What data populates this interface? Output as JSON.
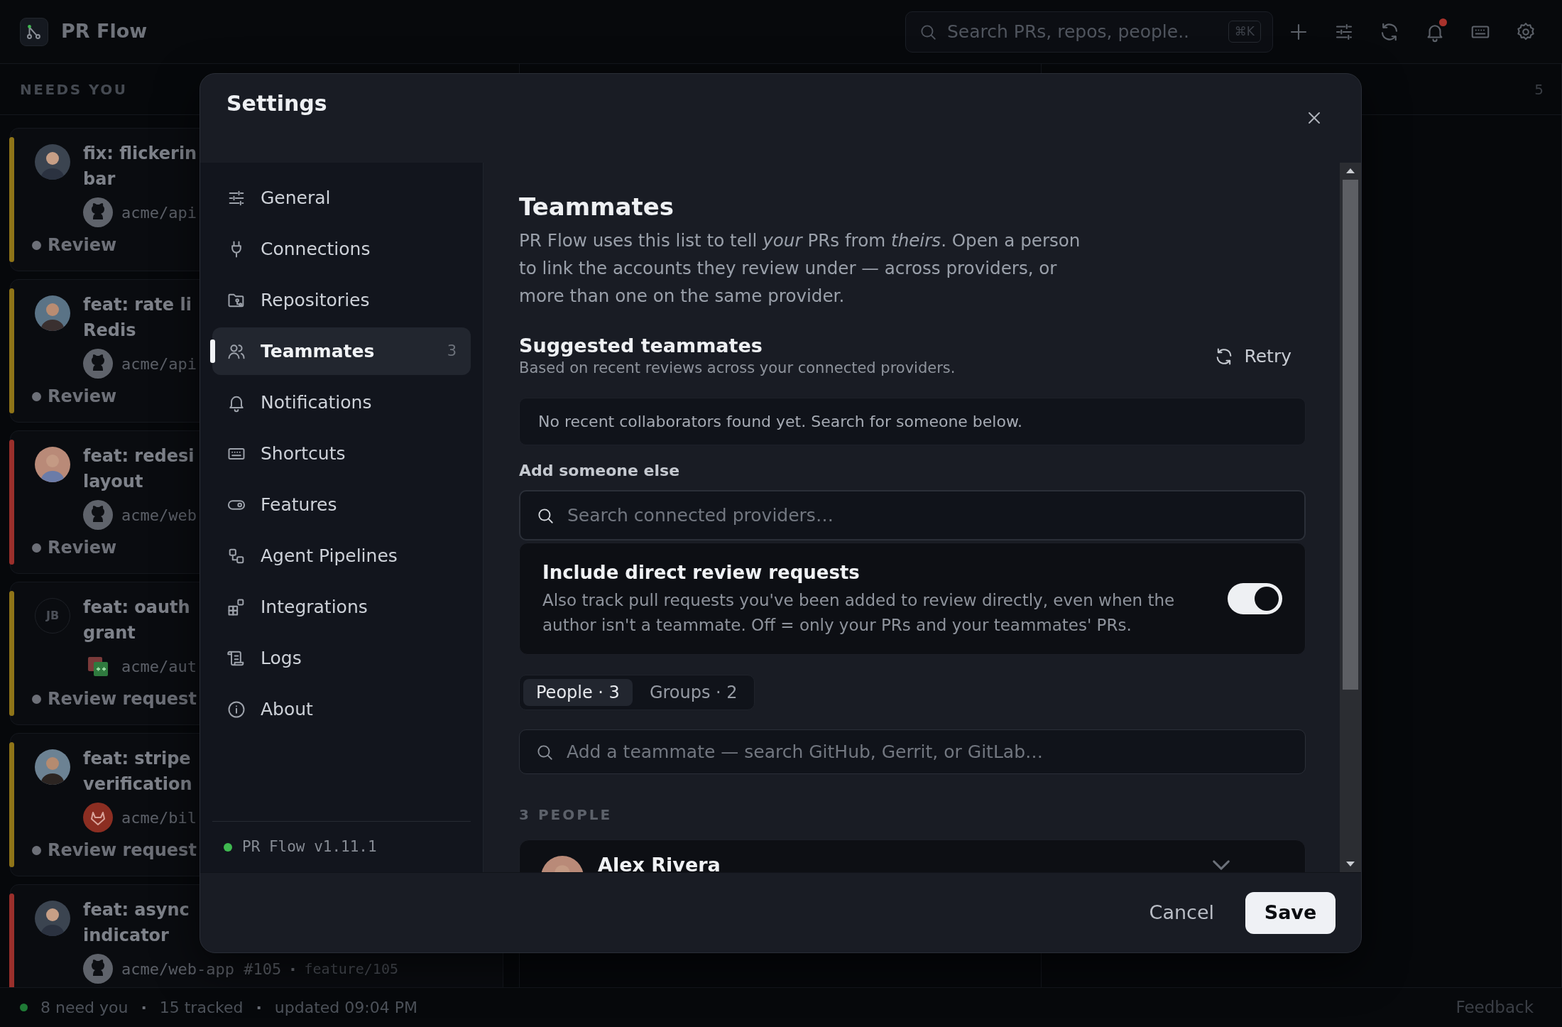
{
  "app": {
    "title": "PR Flow",
    "search": {
      "placeholder": "Search PRs, repos, people..",
      "shortcut": "⌘K"
    },
    "unread_notifications": true
  },
  "columns": [
    {
      "title": "NEEDS YOU",
      "cards": [
        {
          "title_lines": [
            "fix: flickerin",
            "bar"
          ],
          "avatar": {
            "kind": "photo"
          },
          "kind": "github",
          "repo": "acme/api",
          "status": "Review",
          "color": "#8f7418"
        },
        {
          "title_lines": [
            "feat: rate li",
            "Redis"
          ],
          "avatar": {
            "kind": "photo"
          },
          "kind": "github",
          "repo": "acme/api",
          "status": "Review",
          "color": "#8f7418"
        },
        {
          "title_lines": [
            "feat: redesi",
            "layout"
          ],
          "avatar": {
            "kind": "photo"
          },
          "kind": "github",
          "repo": "acme/web",
          "status": "Review",
          "color": "#9a2f2b"
        },
        {
          "title_lines": [
            "feat: oauth",
            "grant"
          ],
          "avatar": {
            "kind": "initials",
            "text": "JB"
          },
          "kind": "gerrit",
          "repo": "acme/aut",
          "status": "Review request",
          "color": "#8f7418"
        },
        {
          "title_lines": [
            "feat: stripe",
            "verification"
          ],
          "avatar": {
            "kind": "photo"
          },
          "kind": "gitlab",
          "repo": "acme/bil",
          "status": "Review request",
          "color": "#8f7418"
        },
        {
          "title_lines": [
            "feat: async",
            "indicator"
          ],
          "avatar": {
            "kind": "photo"
          },
          "kind": "github",
          "repo": "acme/web-app #105",
          "branch": {
            "separator": "·",
            "name": "feature/105"
          },
          "color": "#9a2f2b"
        }
      ]
    },
    {},
    {
      "count": "5"
    }
  ],
  "status_bar": {
    "items": [
      "8 need you",
      "·",
      "15 tracked",
      "·",
      "updated 09:04 PM"
    ],
    "feedback": "Feedback"
  },
  "settings": {
    "title": "Settings",
    "nav": [
      {
        "label": "General",
        "selected": false
      },
      {
        "label": "Connections",
        "selected": false
      },
      {
        "label": "Repositories",
        "selected": false
      },
      {
        "label": "Teammates",
        "selected": true,
        "count": "3"
      },
      {
        "label": "Notifications",
        "selected": false
      },
      {
        "label": "Shortcuts",
        "selected": false
      },
      {
        "label": "Features",
        "selected": false
      },
      {
        "label": "Agent Pipelines",
        "selected": false
      },
      {
        "label": "Integrations",
        "selected": false
      },
      {
        "label": "Logs",
        "selected": false
      },
      {
        "label": "About",
        "selected": false
      }
    ],
    "version": "PR Flow v1.11.1",
    "section": {
      "heading": "Teammates",
      "intro": "PR Flow uses this list to tell *your* PRs from *theirs*. Open a person to link the accounts they review under — across providers, or more than one on the same provider.",
      "suggested": {
        "title": "Suggested teammates",
        "subtitle": "Based on recent reviews across your connected providers.",
        "retry": "Retry",
        "empty": "No recent collaborators found yet. Search for someone below."
      },
      "add_someone": {
        "label": "Add someone else",
        "placeholder": "Search connected providers…"
      },
      "direct_requests": {
        "title": "Include direct review requests",
        "description": "Also track pull requests you've been added to review directly, even when the author isn't a teammate. Off = only your PRs and your teammates' PRs.",
        "on": true
      },
      "tabs": [
        {
          "label": "People · 3",
          "selected": true
        },
        {
          "label": "Groups · 2",
          "selected": false
        }
      ],
      "teammate_search": {
        "placeholder": "Add a teammate — search GitHub, Gerrit, or GitLab…"
      },
      "people_heading": "3 PEOPLE",
      "people": [
        {
          "name": "Alex Rivera"
        }
      ]
    },
    "footer": {
      "cancel": "Cancel",
      "save": "Save"
    }
  }
}
